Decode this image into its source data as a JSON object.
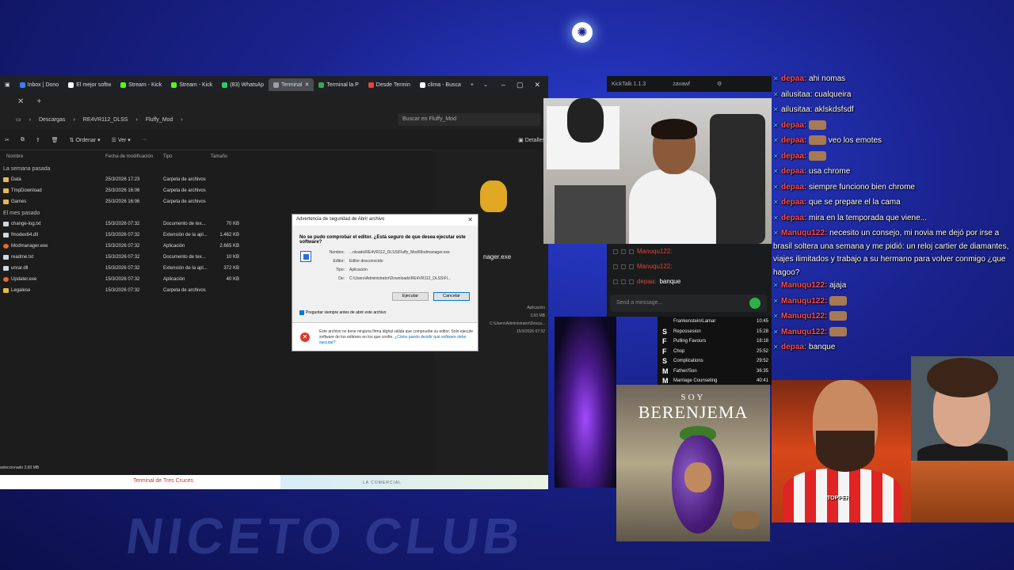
{
  "background": {
    "club_text": "NICETO CLUB"
  },
  "browser": {
    "tabs": [
      {
        "label": "Inbox | Dono",
        "color": "#3d7cff"
      },
      {
        "label": "El mejor softw",
        "color": "#ffffff"
      },
      {
        "label": "Stream - Kick",
        "color": "#53fc18"
      },
      {
        "label": "Stream - Kick",
        "color": "#53fc18"
      },
      {
        "label": "(83) WhatsAp",
        "color": "#25d366"
      },
      {
        "label": "Terminal ",
        "color": "#9aa0a6",
        "active": true
      },
      {
        "label": "Terminal la P",
        "color": "#34a853"
      },
      {
        "label": "Desde Termin",
        "color": "#ea4335"
      },
      {
        "label": "clima - Busca",
        "color": "#ffffff"
      }
    ],
    "new_tab": "+"
  },
  "explorer": {
    "breadcrumb": [
      "Descargas",
      "RE4VR112_DLSS",
      "Fluffy_Mod"
    ],
    "search_placeholder": "Buscar en Fluffy_Mod",
    "commands": [
      "Ordenar",
      "Ver",
      "···"
    ],
    "details_label": "Detalles",
    "columns": [
      "Nombre",
      "Fecha de modificación",
      "Tipo",
      "Tamaño"
    ],
    "groups": [
      {
        "label": "La semana pasada",
        "rows": [
          {
            "name": "Data",
            "date": "25/3/2026 17:23",
            "type": "Carpeta de archivos",
            "size": "",
            "kind": "folder"
          },
          {
            "name": "TmpDownload",
            "date": "25/3/2026 16:06",
            "type": "Carpeta de archivos",
            "size": "",
            "kind": "folder"
          },
          {
            "name": "Games",
            "date": "25/3/2026 16:06",
            "type": "Carpeta de archivos",
            "size": "",
            "kind": "folder"
          }
        ]
      },
      {
        "label": "El mes pasado",
        "rows": [
          {
            "name": "change-log.txt",
            "date": "15/3/2026 07:32",
            "type": "Documento de tex...",
            "size": "70 KB",
            "kind": "file"
          },
          {
            "name": "fmodex64.dll",
            "date": "15/3/2026 07:32",
            "type": "Extensión de la apl...",
            "size": "1.462 KB",
            "kind": "file"
          },
          {
            "name": "Modmanager.exe",
            "date": "15/3/2026 07:32",
            "type": "Aplicación",
            "size": "2.665 KB",
            "kind": "exe"
          },
          {
            "name": "readme.txt",
            "date": "15/3/2026 07:32",
            "type": "Documento de tex...",
            "size": "10 KB",
            "kind": "file"
          },
          {
            "name": "unrar.dll",
            "date": "15/3/2026 07:32",
            "type": "Extensión de la apl...",
            "size": "372 KB",
            "kind": "file"
          },
          {
            "name": "Updater.exe",
            "date": "15/3/2026 07:32",
            "type": "Aplicación",
            "size": "40 KB",
            "kind": "exe"
          },
          {
            "name": "Legalese",
            "date": "15/3/2026 07:32",
            "type": "Carpeta de archivos",
            "size": "",
            "kind": "folder"
          }
        ]
      }
    ],
    "preview": {
      "name": "nager.exe",
      "info_lines": [
        "Aplicación",
        "2,60 MB",
        "C:\\Users\\Administrator\\Desca...",
        "15/3/2026 07:32"
      ]
    },
    "status": "seleccionado  2,60 MB"
  },
  "map": {
    "title": "Terminal de Tres Cruces",
    "area": "LA COMERCIAL"
  },
  "dialog": {
    "title": "Advertencia de seguridad de Abrir archivo",
    "question": "No se pudo comprobar el editor. ¿Está seguro de que desea ejecutar este software?",
    "fields": [
      {
        "label": "Nombre:",
        "value": "...nloads\\RE4VR112_DLSS\\Fluffy_Mod\\Modmanager.exe"
      },
      {
        "label": "Editor:",
        "value": "Editor desconocido"
      },
      {
        "label": "Tipo:",
        "value": "Aplicación"
      },
      {
        "label": "De:",
        "value": "C:\\Users\\Administrator\\Downloads\\RE4VR112_DLSS\\Fl..."
      }
    ],
    "run_label": "Ejecutar",
    "cancel_label": "Cancelar",
    "checkbox_label": "Preguntar siempre antes de abrir este archivo",
    "warning_text": "Este archivo no tiene ninguna firma digital válida que compruebe su editor. Solo ejecute software de los editores en los que confíe.",
    "warning_link": "¿Cómo puedo decidir qué software debo ejecutar?"
  },
  "kicktalk": {
    "app_title": "KickTalk 1.1.3",
    "channel": "zavawf",
    "messages": [
      {
        "user": "Manuqu122:",
        "text": "",
        "user_color": "#e0443a"
      },
      {
        "user": "Manuqu122:",
        "text": "",
        "user_color": "#e0443a"
      },
      {
        "user": "depaa:",
        "text": "banque",
        "user_color": "#e0443a"
      }
    ],
    "input_placeholder": "Send a message..."
  },
  "playlist": [
    {
      "badge": "",
      "title": "Frankenstein/Lamar",
      "time": "10:45"
    },
    {
      "badge": "S",
      "title": "Repossesion",
      "time": "15:28"
    },
    {
      "badge": "F",
      "title": "Pulling Favours",
      "time": "18:18"
    },
    {
      "badge": "F",
      "title": "Chop",
      "time": "25:52"
    },
    {
      "badge": "S",
      "title": "Complications",
      "time": "29:52"
    },
    {
      "badge": "M",
      "title": "Father/Son",
      "time": "36:35"
    },
    {
      "badge": "M",
      "title": "Marriage Counseling",
      "time": "40:41"
    }
  ],
  "poster": {
    "soy": "SOY",
    "title": "BERENJEMA"
  },
  "chat": [
    {
      "user": "depaa:",
      "text": "ahi nomas",
      "color": "#ff4d4d"
    },
    {
      "user": "",
      "text": "ailusitaa: cualqueira",
      "color": "#ffffff"
    },
    {
      "user": "",
      "text": "ailusitaa: aklskdsfsdf",
      "color": "#ffffff"
    },
    {
      "user": "depaa:",
      "text": "",
      "color": "#ff4d4d"
    },
    {
      "user": "depaa:",
      "text": "veo los emotes",
      "color": "#ff4d4d"
    },
    {
      "user": "depaa:",
      "text": "",
      "color": "#ff4d4d"
    },
    {
      "user": "depaa:",
      "text": "usa chrome",
      "color": "#ff4d4d"
    },
    {
      "user": "depaa:",
      "text": "siempre funciono bien chrome",
      "color": "#ff4d4d"
    },
    {
      "user": "depaa:",
      "text": "que se prepare el la cama",
      "color": "#ff4d4d"
    },
    {
      "user": "depaa:",
      "text": "mira en la temporada que viene...",
      "color": "#ff4d4d"
    },
    {
      "user": "Manuqu122:",
      "text": "necesito un consejo, mi novia me dejó por irse a brasil soltera una semana y me pidió: un reloj cartier de diamantes, viajes ilimitados y trabajo a su hermano para volver conmigo ¿que hagoo?",
      "color": "#ff4d4d"
    },
    {
      "user": "Manuqu122:",
      "text": "ajaja",
      "color": "#ff4d4d"
    },
    {
      "user": "Manuqu122:",
      "text": "",
      "color": "#ff4d4d"
    },
    {
      "user": "Manuqu122:",
      "text": "",
      "color": "#ff4d4d"
    },
    {
      "user": "Manuqu122:",
      "text": "",
      "color": "#ff4d4d"
    },
    {
      "user": "depaa:",
      "text": "banque",
      "color": "#ff4d4d"
    }
  ],
  "reactor_cam": {
    "shirt_logo": "TOPPER"
  }
}
